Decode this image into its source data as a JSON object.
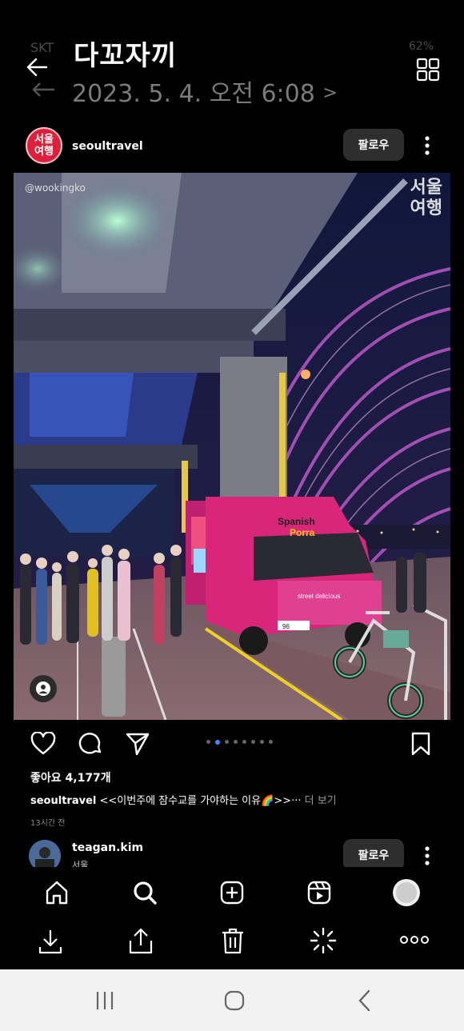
{
  "status": {
    "carrier": "SKT",
    "right": "62%"
  },
  "header": {
    "album_title": "다꼬자끼",
    "datetime": "2023. 5. 4. 오전 6:08",
    "datetime_arrow": ">"
  },
  "post": {
    "username": "seoultravel",
    "avatar_text": "서울\n여행",
    "follow_label": "팔로우",
    "photo": {
      "credit": "@wookingko",
      "watermark": "서울\n여행",
      "truck_brand": "Spanish",
      "truck_brand2": "Porra",
      "truck_slogan": "street delicious",
      "plate": "96"
    },
    "carousel": {
      "count": 8,
      "active_index": 1
    },
    "likes": "좋아요 4,177개",
    "caption_user": "seoultravel",
    "caption_text": "<<이번주에 잠수교를 가야하는 이유🌈>>···",
    "caption_more": "더 보기",
    "time_ago": "13시간 전"
  },
  "next_post": {
    "username": "teagan.kim",
    "location": "서울",
    "follow_label": "팔로우"
  },
  "instagram_tabs": [
    "home",
    "search",
    "create",
    "reels",
    "profile"
  ],
  "gallery_actions": [
    "download",
    "share",
    "delete",
    "edit",
    "more"
  ],
  "system_nav": [
    "recents",
    "home",
    "back"
  ],
  "colors": {
    "follow_bg": "#2e2e2e",
    "accent": "#3b8cff",
    "truck": "#d9267a"
  }
}
